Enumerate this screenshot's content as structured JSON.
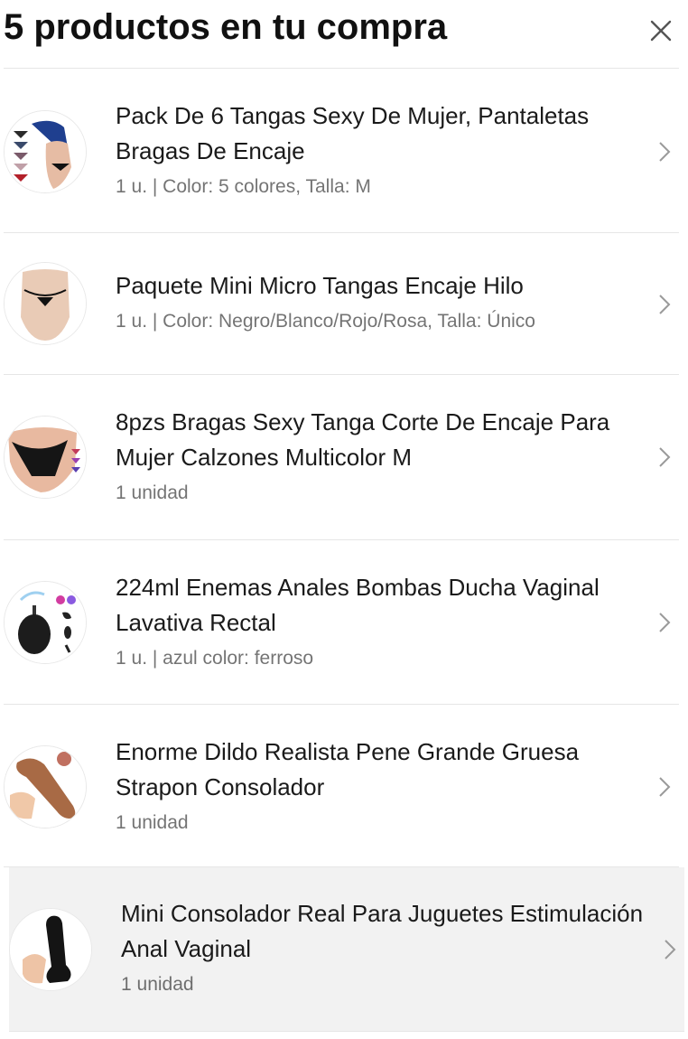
{
  "header": {
    "title": "5 productos en tu compra",
    "close_icon": "close-icon"
  },
  "products": [
    {
      "name": "Pack De 6 Tangas Sexy De Mujer, Pantaletas Bragas De Encaje",
      "meta": "1 u. | Color: 5 colores, Talla: M",
      "thumbnail": "product-thumbnail-1"
    },
    {
      "name": "Paquete Mini Micro Tangas Encaje Hilo",
      "meta": "1 u. | Color: Negro/Blanco/Rojo/Rosa, Talla: Único",
      "thumbnail": "product-thumbnail-2"
    },
    {
      "name": "8pzs Bragas Sexy Tanga Corte De Encaje Para Mujer Calzones Multicolor M",
      "meta": "1 unidad",
      "thumbnail": "product-thumbnail-3"
    },
    {
      "name": "224ml Enemas Anales Bombas Ducha Vaginal Lavativa Rectal",
      "meta": "1 u. | azul color: ferroso",
      "thumbnail": "product-thumbnail-4"
    },
    {
      "name": "Enorme Dildo Realista Pene Grande Gruesa Strapon Consolador",
      "meta": "1 unidad",
      "thumbnail": "product-thumbnail-5"
    },
    {
      "name": "Mini Consolador Real Para Juguetes Estimulación Anal Vaginal",
      "meta": "1 unidad",
      "thumbnail": "product-thumbnail-6",
      "selected": true
    }
  ],
  "colors": {
    "divider": "#e6e6e6",
    "selected_background": "#f2f2f2",
    "meta_text": "rgba(0,0,0,0.55)"
  }
}
